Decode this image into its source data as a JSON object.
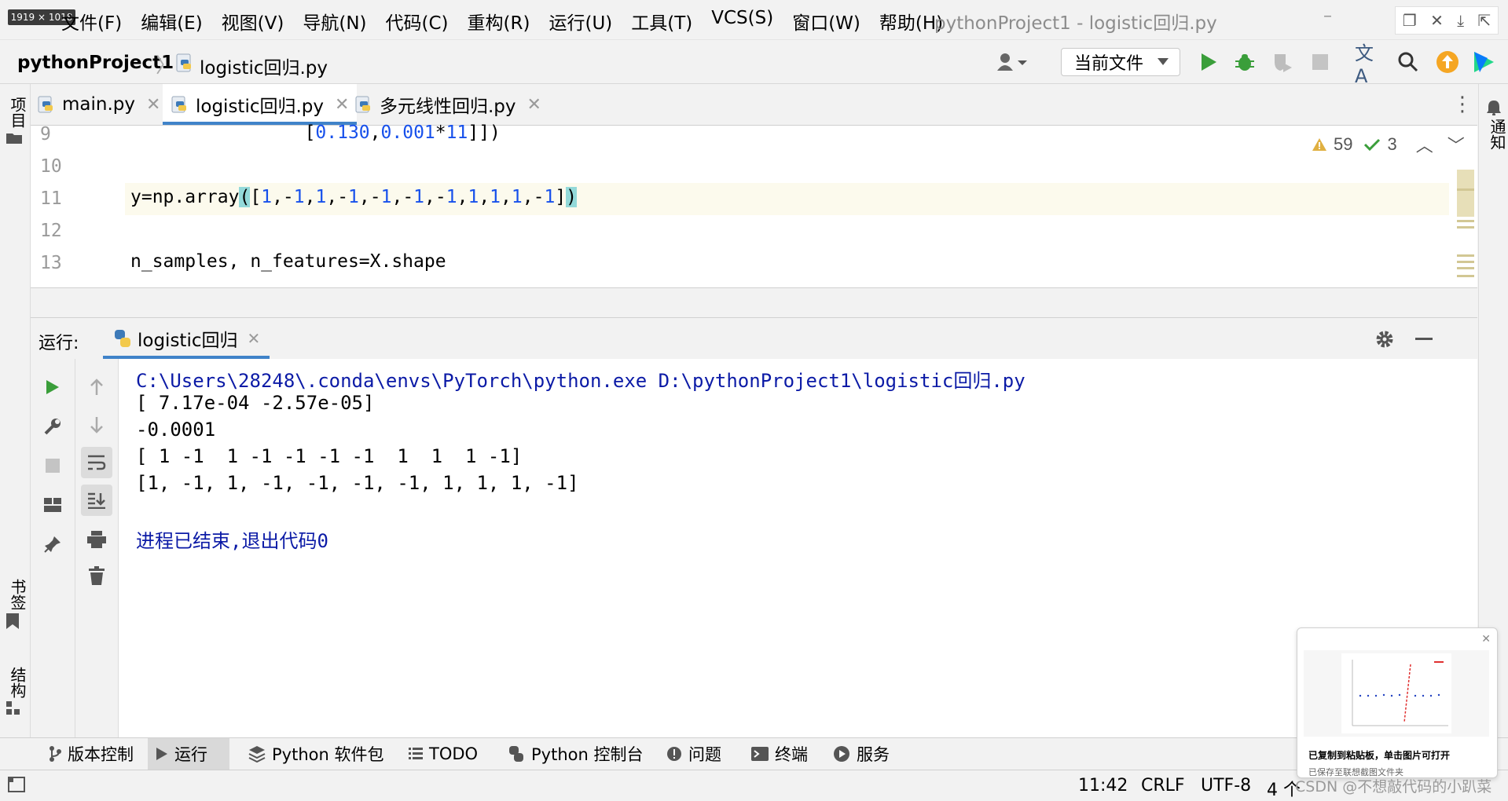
{
  "window": {
    "dimensions_badge": "1919 × 1018",
    "menu": [
      "文件(F)",
      "编辑(E)",
      "视图(V)",
      "导航(N)",
      "代码(C)",
      "重构(R)",
      "运行(U)",
      "工具(T)",
      "VCS(S)",
      "窗口(W)",
      "帮助(H)"
    ],
    "title": "pythonProject1 - logistic回归.py"
  },
  "navbar": {
    "project": "pythonProject1",
    "file": "logistic回归.py",
    "run_config": "当前文件"
  },
  "left_strip": {
    "project": "项目",
    "bookmarks": "书签",
    "structure": "结构"
  },
  "right_strip": {
    "notifications": "通知"
  },
  "editor_tabs": [
    {
      "label": "main.py"
    },
    {
      "label": "logistic回归.py"
    },
    {
      "label": "多元线性回归.py"
    }
  ],
  "editor": {
    "line_numbers": [
      "9",
      "10",
      "11",
      "12",
      "13"
    ],
    "line9": {
      "indent": "        ",
      "open": "[",
      "n1": "0.130",
      "comma": ",",
      "n2": "0.001",
      "star": "*",
      "n3": "11",
      "close": "]])"
    },
    "line11": {
      "prefix": "y=np.array",
      "open_paren": "(",
      "open_bracket": "[",
      "close_bracket": "]",
      "close_paren": ")",
      "values": [
        "1",
        ",-",
        "1",
        ",",
        "1",
        ",-",
        "1",
        ",-",
        "1",
        ",-",
        "1",
        ",-",
        "1",
        ",",
        "1",
        ",",
        "1",
        ",",
        "1",
        ",-",
        "1"
      ]
    },
    "line13": "n_samples, n_features=X.shape",
    "warnings": "59",
    "ok_count": "3"
  },
  "run_panel": {
    "label": "运行:",
    "tab": "logistic回归",
    "output": [
      "C:\\Users\\28248\\.conda\\envs\\PyTorch\\python.exe D:\\pythonProject1\\logistic回归.py",
      "[ 7.17e-04 -2.57e-05]",
      "-0.0001",
      "[ 1 -1  1 -1 -1 -1 -1  1  1  1 -1]",
      "[1, -1, 1, -1, -1, -1, -1, 1, 1, 1, -1]",
      "",
      "进程已结束,退出代码0"
    ]
  },
  "bottom_tools": [
    "版本控制",
    "运行",
    "Python 软件包",
    "TODO",
    "Python 控制台",
    "问题",
    "终端",
    "服务"
  ],
  "status": {
    "position": "11:42",
    "line_sep": "CRLF",
    "encoding": "UTF-8",
    "indent": "4 个"
  },
  "notification": {
    "title": "已复制到粘贴板，单击图片可打开",
    "subtitle": "已保存至联想截图文件夹"
  },
  "watermark": "CSDN @不想敲代码的小趴菜",
  "colors": {
    "accent": "#4083c9",
    "run_green": "#3a9e3a",
    "number_blue": "#1750eb",
    "console_path": "#0b1aa6",
    "bracket_hl": "#93d9d9"
  }
}
